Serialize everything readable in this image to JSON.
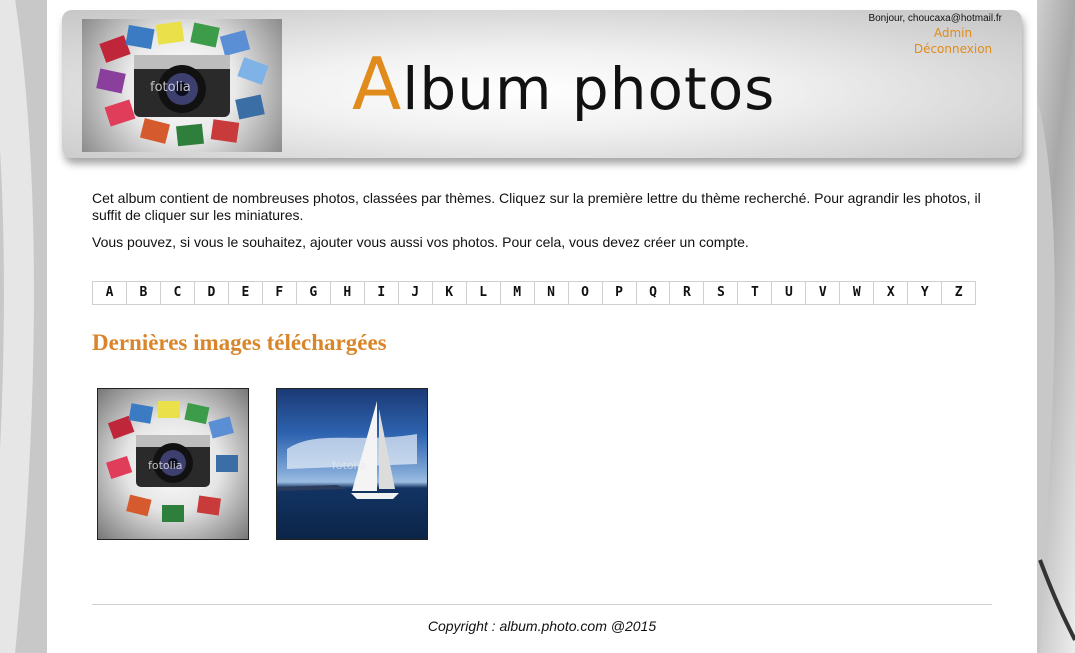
{
  "header": {
    "title_first_letter": "A",
    "title_rest": "lbum photos",
    "greeting": "Bonjour, choucaxa@hotmail.fr",
    "admin_link": "Admin",
    "logout_link": "Déconnexion"
  },
  "intro": {
    "paragraph1": "Cet album contient de nombreuses photos, classées par thèmes. Cliquez sur la première lettre du thème recherché. Pour agrandir les photos, il suffit de cliquer sur les miniatures.",
    "paragraph2": "Vous pouvez, si vous le souhaitez, ajouter vous aussi vos photos. Pour cela, vous devez créer un compte."
  },
  "alphabet": [
    "A",
    "B",
    "C",
    "D",
    "E",
    "F",
    "G",
    "H",
    "I",
    "J",
    "K",
    "L",
    "M",
    "N",
    "O",
    "P",
    "Q",
    "R",
    "S",
    "T",
    "U",
    "V",
    "W",
    "X",
    "Y",
    "Z"
  ],
  "latest": {
    "title": "Dernières images téléchargées",
    "images": [
      {
        "subject": "camera-collage-image",
        "watermark": "fotolia"
      },
      {
        "subject": "sailboat-image",
        "watermark": "fotolia"
      }
    ]
  },
  "footer": {
    "copyright": "Copyright : album.photo.com @2015"
  },
  "colors": {
    "accent": "#e08b1c",
    "section_title": "#d9862b"
  }
}
